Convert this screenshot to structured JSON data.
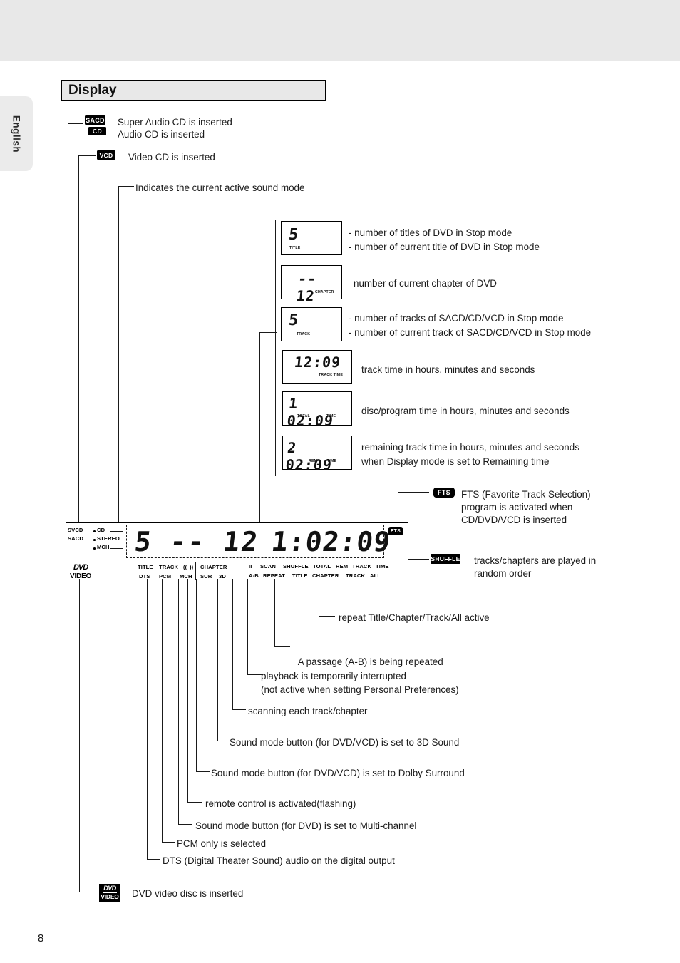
{
  "page": {
    "language_tab": "English",
    "section_title": "Display",
    "page_number": "8"
  },
  "top_callouts": [
    {
      "badge": "SACD",
      "text": "Super Audio CD is inserted"
    },
    {
      "badge": "CD",
      "text": "Audio CD is inserted"
    },
    {
      "badge": "VCD",
      "text": "Video CD is inserted"
    },
    {
      "badge": "",
      "text": "Indicates the current active sound mode"
    }
  ],
  "sample_displays": [
    {
      "name": "title-display",
      "value": "5",
      "label": "TITLE",
      "descriptions": [
        "- number of titles of DVD in Stop mode",
        "- number of current title of DVD in Stop mode"
      ]
    },
    {
      "name": "chapter-display",
      "value": "-- 12",
      "label": "CHAPTER",
      "descriptions": [
        "number of current chapter of DVD"
      ]
    },
    {
      "name": "track-display",
      "value": "5",
      "label": "TRACK",
      "descriptions": [
        "- number of tracks of SACD/CD/VCD in Stop mode",
        "- number of current track of SACD/CD/VCD in Stop mode"
      ]
    },
    {
      "name": "track-time-display",
      "value": "12:09",
      "label": "TRACK TIME",
      "descriptions": [
        "track time in hours, minutes and seconds"
      ]
    },
    {
      "name": "total-time-display",
      "value": "1 02:09",
      "label_left": "TOTAL",
      "label_right": "TIME",
      "descriptions": [
        "disc/program time in hours, minutes and seconds"
      ]
    },
    {
      "name": "rem-time-display",
      "value": "2 02:09",
      "label_left": "REM",
      "label_right": "TIME",
      "descriptions": [
        "remaining track time in hours, minutes and seconds",
        "when Display mode is set to Remaining time"
      ]
    }
  ],
  "right_callouts": [
    {
      "badge": "FTS",
      "lines": [
        "FTS (Favorite Track Selection)",
        "program is activated when",
        "CD/DVD/VCD is inserted"
      ]
    },
    {
      "badge": "SHUFFLE",
      "lines": [
        "tracks/chapters are played in",
        "random order"
      ]
    }
  ],
  "main_display": {
    "left_labels": {
      "svcd": "SVCD",
      "sacd": "SACD",
      "cd": "CD",
      "stereo": "STEREO",
      "mch": "MCH"
    },
    "dvd_logo": {
      "top": "DVD",
      "bottom": "VIDEO"
    },
    "lcd_left": "5 -- 12",
    "lcd_right": "1:02:09",
    "fts_badge": "FTS",
    "indicator_row_1": [
      "TITLE",
      "TRACK",
      "((",
      "))",
      "CHAPTER"
    ],
    "indicator_row_2": [
      "DTS",
      "PCM",
      "MCH",
      "SUR",
      "3D"
    ],
    "status_row_1": [
      "II",
      "SCAN",
      "SHUFFLE",
      "TOTAL",
      "REM",
      "TRACK",
      "TIME"
    ],
    "status_row_2": [
      "A-B",
      "REPEAT",
      "TITLE",
      "CHAPTER",
      "TRACK",
      "ALL"
    ]
  },
  "bottom_callouts": [
    "repeat Title/Chapter/Track/All active",
    "A passage (A-B) is being repeated",
    "playback is temporarily interrupted",
    "(not active when setting Personal Preferences)",
    "scanning each track/chapter",
    "Sound mode button (for DVD/VCD) is set to 3D Sound",
    "Sound mode button (for DVD/VCD) is set to Dolby Surround",
    "remote control is activated(flashing)",
    "Sound mode button (for DVD) is set to Multi-channel",
    "PCM only is selected",
    "DTS (Digital Theater Sound) audio on the digital output",
    "DVD video disc is inserted"
  ],
  "colors": {
    "band": "#e8e8e8",
    "title_bg": "#e8e8e8",
    "ink": "#1a1a1a",
    "badge_bg": "#000000"
  }
}
